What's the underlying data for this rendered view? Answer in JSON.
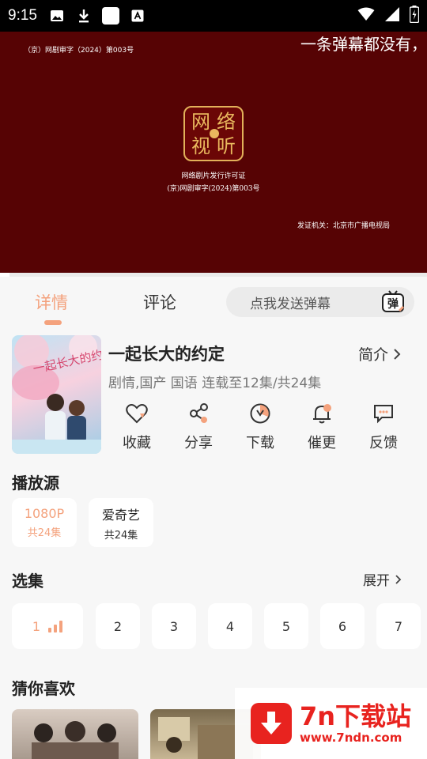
{
  "status_bar": {
    "time": "9:15"
  },
  "player": {
    "license_top": "（京）网剧审字（2024）第003号",
    "danmaku_text": "一条弹幕都没有，",
    "seal_chars": [
      "网",
      "络",
      "视",
      "听"
    ],
    "cert_line1": "网络剧片发行许可证",
    "cert_line2": "(京)网剧审字(2024)第003号",
    "issuer": "发证机关：北京市广播电视局"
  },
  "tabs": {
    "detail": "详情",
    "comment": "评论"
  },
  "danmaku_input": {
    "placeholder": "点我发送弹幕",
    "button_label": "弹"
  },
  "show": {
    "title": "一起长大的约定",
    "intro_label": "简介",
    "meta": "剧情,国产 国语 连载至12集/共24集",
    "poster_text": "一起长大的约定"
  },
  "actions": [
    {
      "label": "收藏",
      "icon": "heart-icon"
    },
    {
      "label": "分享",
      "icon": "share-icon"
    },
    {
      "label": "下载",
      "icon": "download-icon"
    },
    {
      "label": "催更",
      "icon": "bell-icon"
    },
    {
      "label": "反馈",
      "icon": "feedback-icon"
    }
  ],
  "sources": {
    "title": "播放源",
    "items": [
      {
        "name": "1080P",
        "count": "共24集"
      },
      {
        "name": "爱奇艺",
        "count": "共24集"
      }
    ]
  },
  "episodes": {
    "title": "选集",
    "expand_label": "展开",
    "items": [
      "1",
      "2",
      "3",
      "4",
      "5",
      "6",
      "7"
    ]
  },
  "recommend": {
    "title": "猜你喜欢"
  },
  "watermark": {
    "brand": "7n下载站",
    "url": "www.7ndn.com"
  },
  "colors": {
    "accent": "#f4a27d",
    "player_bg": "#560304",
    "watermark_red": "#e8231f"
  }
}
